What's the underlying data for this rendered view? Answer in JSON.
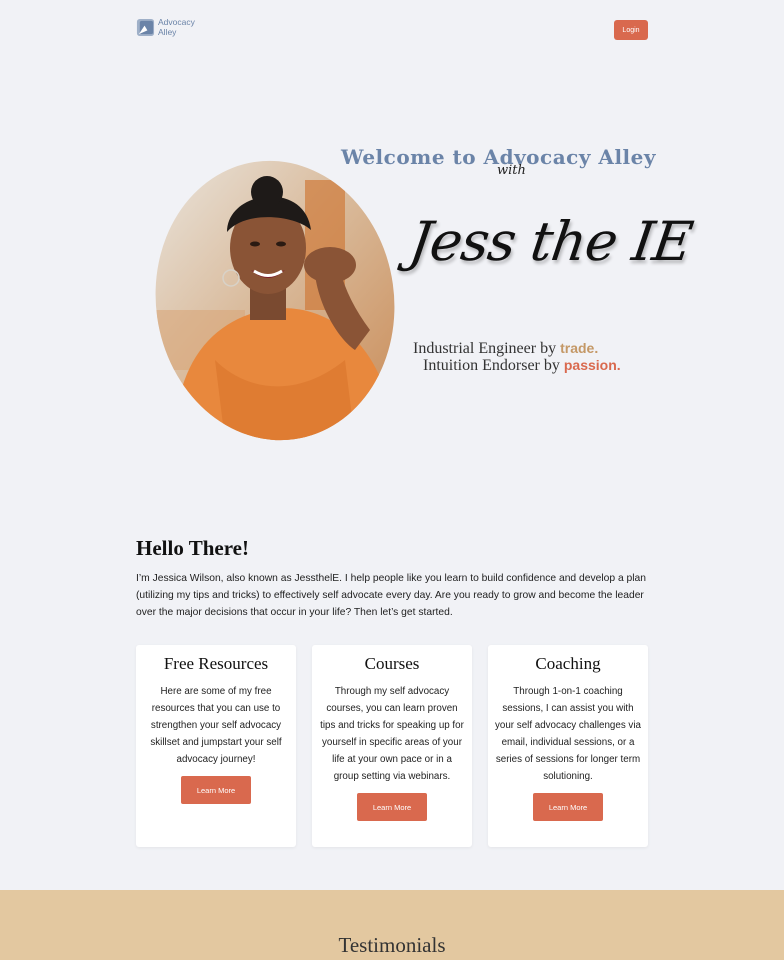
{
  "header": {
    "logo_line1": "Advocacy",
    "logo_line2": "Alley",
    "login_label": "Login"
  },
  "hero": {
    "title": "Welcome to Advocacy Alley",
    "with": "with",
    "signature": "Jess the IE",
    "line1_prefix": "Industrial Engineer by ",
    "line1_keyword": "trade.",
    "line2_prefix": "Intuition Endorser by ",
    "line2_keyword": "passion."
  },
  "intro": {
    "heading": "Hello There!",
    "body": "I’m Jessica Wilson, also known as JessthelE. I help people like you learn to build confidence and develop a plan (utilizing my tips and tricks) to effectively self advocate every day. Are you ready to grow and become the leader over the major decisions that occur in your life? Then let’s get started."
  },
  "cards": [
    {
      "title": "Free Resources",
      "body": "Here are some of my free resources that you can use to strengthen your self advocacy skillset and jumpstart your self advocacy journey!",
      "button": "Learn More"
    },
    {
      "title": "Courses",
      "body": "Through my self advocacy courses, you can learn proven tips and tricks for speaking up for yourself in specific areas of your life at your own pace or in a group setting via webinars.",
      "button": "Learn More"
    },
    {
      "title": "Coaching",
      "body": "Through 1-on-1 coaching sessions, I can assist you with your self advocacy challenges via email, individual sessions, or a series of sessions for longer term solutioning.",
      "button": "Learn More"
    }
  ],
  "testimonials": {
    "heading": "Testimonials"
  },
  "colors": {
    "accent": "#d9694e",
    "brand_blue": "#6b84a8",
    "trade_tan": "#c49866",
    "band": "#e3c8a0",
    "background": "#f1f2f6"
  }
}
